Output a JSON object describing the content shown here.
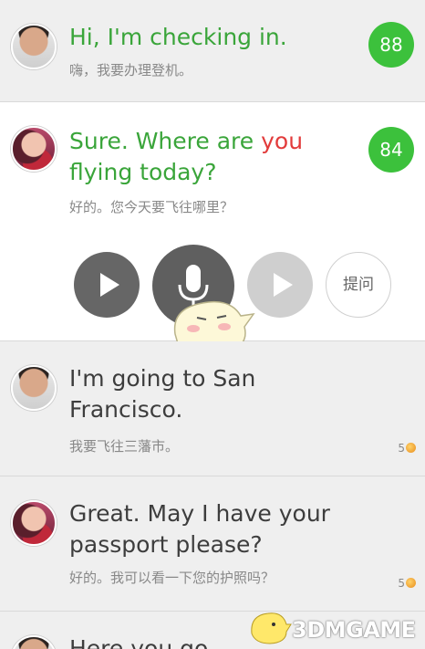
{
  "messages": [
    {
      "en": "Hi, I'm checking in.",
      "cn": "嗨，我要办理登机。",
      "score": "88"
    },
    {
      "en_part1": "Sure. Where are ",
      "en_highlight": "you",
      "en_part2": "flying today?",
      "cn": "好的。您今天要飞往哪里？",
      "score": "84"
    },
    {
      "en_line1": "I'm going to San",
      "en_line2": "Francisco.",
      "cn": "我要飞往三藩市。",
      "coins": "5"
    },
    {
      "en_line1": "Great. May I have your",
      "en_line2": "passport please?",
      "cn": "好的。我可以看一下您的护照吗？",
      "coins": "5"
    },
    {
      "en": "Here you go."
    }
  ],
  "controls": {
    "ask_label": "提问",
    "icons": [
      "play-icon",
      "microphone-icon",
      "play-icon",
      "ask-question"
    ]
  },
  "watermark": "3DMGAME",
  "colors": {
    "green": "#3aa53a",
    "score_bg": "#3cc13c",
    "highlight": "#e23b3b"
  }
}
